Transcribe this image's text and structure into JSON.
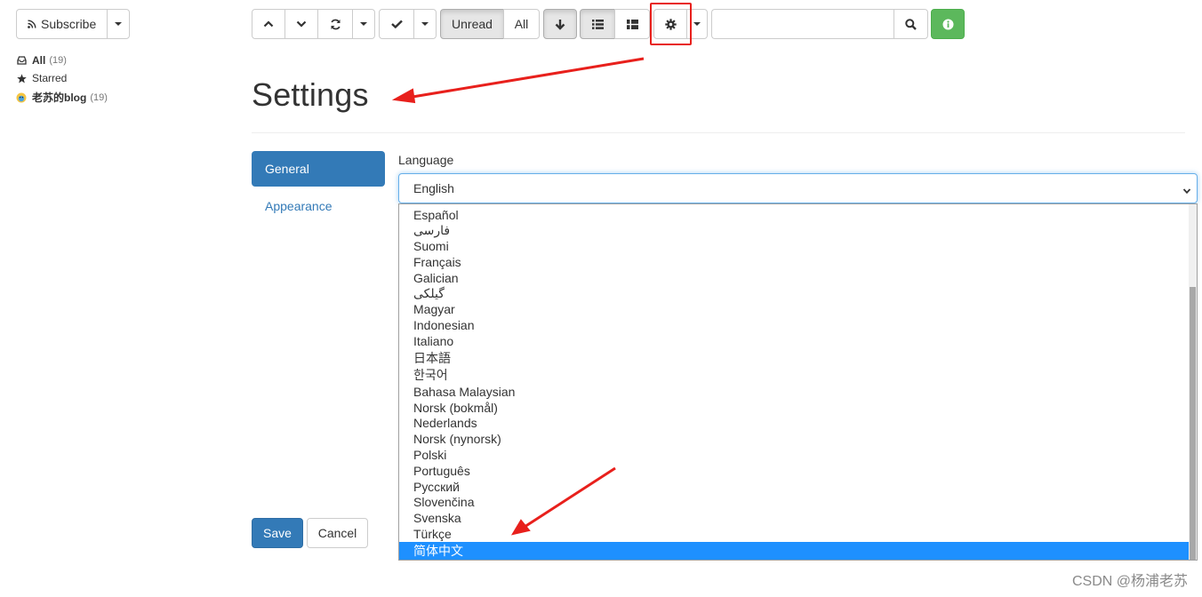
{
  "colors": {
    "primary": "#337ab7",
    "success": "#5cb85c",
    "annotation_red": "#e8201c",
    "selected_option": "#1e90ff"
  },
  "sidebar": {
    "subscribe_label": "Subscribe",
    "items": [
      {
        "icon": "inbox-icon",
        "label": "All",
        "count": "(19)"
      },
      {
        "icon": "star-icon",
        "label": "Starred",
        "count": ""
      },
      {
        "icon": "feed-favicon-icon",
        "label": "老苏的blog",
        "count": "(19)"
      }
    ]
  },
  "toolbar": {
    "unread_label": "Unread",
    "all_label": "All",
    "search_placeholder": "",
    "icons": [
      "chevron-up-icon",
      "chevron-down-icon",
      "refresh-icon",
      "check-icon",
      "arrow-down-icon",
      "list-icon",
      "expanded-list-icon",
      "gear-icon",
      "search-icon",
      "info-icon"
    ]
  },
  "settings": {
    "title": "Settings",
    "nav": [
      {
        "label": "General",
        "active": true
      },
      {
        "label": "Appearance",
        "active": false
      }
    ],
    "language_label": "Language",
    "language_value": "English",
    "language_options": [
      "Español",
      "فارسی",
      "Suomi",
      "Français",
      "Galician",
      "گیلکی",
      "Magyar",
      "Indonesian",
      "Italiano",
      "日本語",
      "한국어",
      "Bahasa Malaysian",
      "Norsk (bokmål)",
      "Nederlands",
      "Norsk (nynorsk)",
      "Polski",
      "Português",
      "Русский",
      "Slovenčina",
      "Svenska",
      "Türkçe",
      "简体中文"
    ],
    "selected_option": "简体中文",
    "save_label": "Save",
    "cancel_label": "Cancel"
  },
  "watermark": "CSDN @杨浦老苏"
}
